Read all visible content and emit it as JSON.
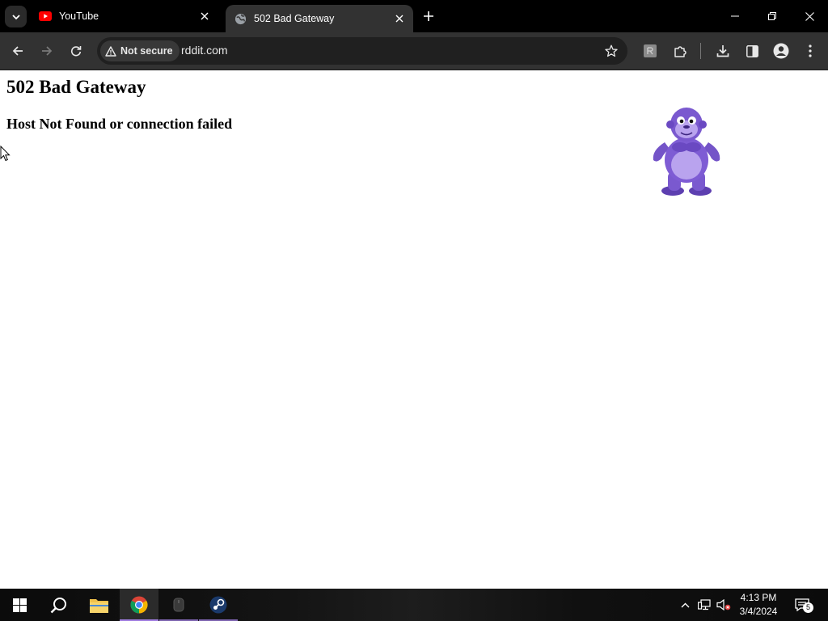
{
  "browser": {
    "tabs": [
      {
        "title": "YouTube",
        "favicon": "youtube-icon",
        "active": false
      },
      {
        "title": "502 Bad Gateway",
        "favicon": "globe-icon",
        "active": true
      }
    ],
    "address_bar": {
      "security_label": "Not secure",
      "url": "rddit.com"
    }
  },
  "page": {
    "heading": "502 Bad Gateway",
    "subheading": "Host Not Found or connection failed",
    "image": "purple-gorilla-mascot"
  },
  "taskbar": {
    "apps": [
      "start-icon",
      "search-icon",
      "file-explorer-icon",
      "chrome-icon",
      "app-icon",
      "steam-icon"
    ],
    "clock": {
      "time": "4:13 PM",
      "date": "3/4/2024"
    },
    "notification_count": "5"
  },
  "colors": {
    "tabstrip": "#000000",
    "toolbar": "#323232",
    "omnibox": "#202020",
    "youtube_red": "#ff0000",
    "active_underline": "#a07de0"
  }
}
